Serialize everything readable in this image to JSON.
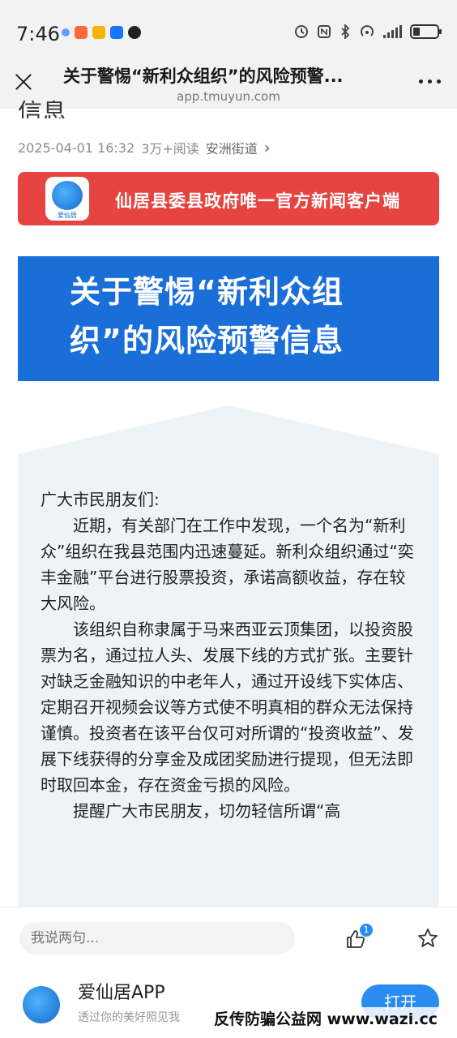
{
  "status_bar": {
    "time": "7:46",
    "app_icon_colors": [
      "#5aa0ff",
      "#ff6a3a",
      "#f5b400",
      "#1677ff",
      "#222222"
    ]
  },
  "nav": {
    "title": "关于警惕“新利众组织”的风险预警...",
    "url": "app.tmuyun.com"
  },
  "article": {
    "cut_title": "信息",
    "meta_date": "2025-04-01 16:32",
    "meta_reads": "3万+阅读",
    "meta_source": "安洲街道",
    "meta_chevron": "›",
    "banner_text": "仙居县委县政府唯一官方新闻客户端",
    "banner_logo_label": "爱仙居",
    "heading": "关于警惕“新利众组织”的风险预警信息",
    "greeting": "广大市民朋友们:",
    "paragraphs": [
      "近期，有关部门在工作中发现，一个名为“新利众”组织在我县范围内迅速蔓延。新利众组织通过“奕丰金融”平台进行股票投资，承诺高额收益，存在较大风险。",
      "该组织自称隶属于马来西亚云顶集团，以投资股票为名，通过拉人头、发展下线的方式扩张。主要针对缺乏金融知识的中老年人，通过开设线下实体店、定期召开视频会议等方式使不明真相的群众无法保持谨慎。投资者在该平台仅可对所谓的“投资收益”、发展下线获得的分享金及成团奖励进行提现，但无法即时取回本金，存在资金亏损的风险。",
      "提醒广大市民朋友，切勿轻信所谓“高"
    ]
  },
  "comment_bar": {
    "placeholder": "我说两句...",
    "like_count": "1"
  },
  "promo": {
    "app_name": "爱仙居APP",
    "subtitle": "透过你的美好照见我",
    "open_label": "打开"
  },
  "watermark": "反传防骗公益网 www.wazi.cc",
  "colors": {
    "banner_red": "#e64440",
    "heading_blue": "#1a6ed8",
    "accent_blue": "#2a8cf0"
  }
}
